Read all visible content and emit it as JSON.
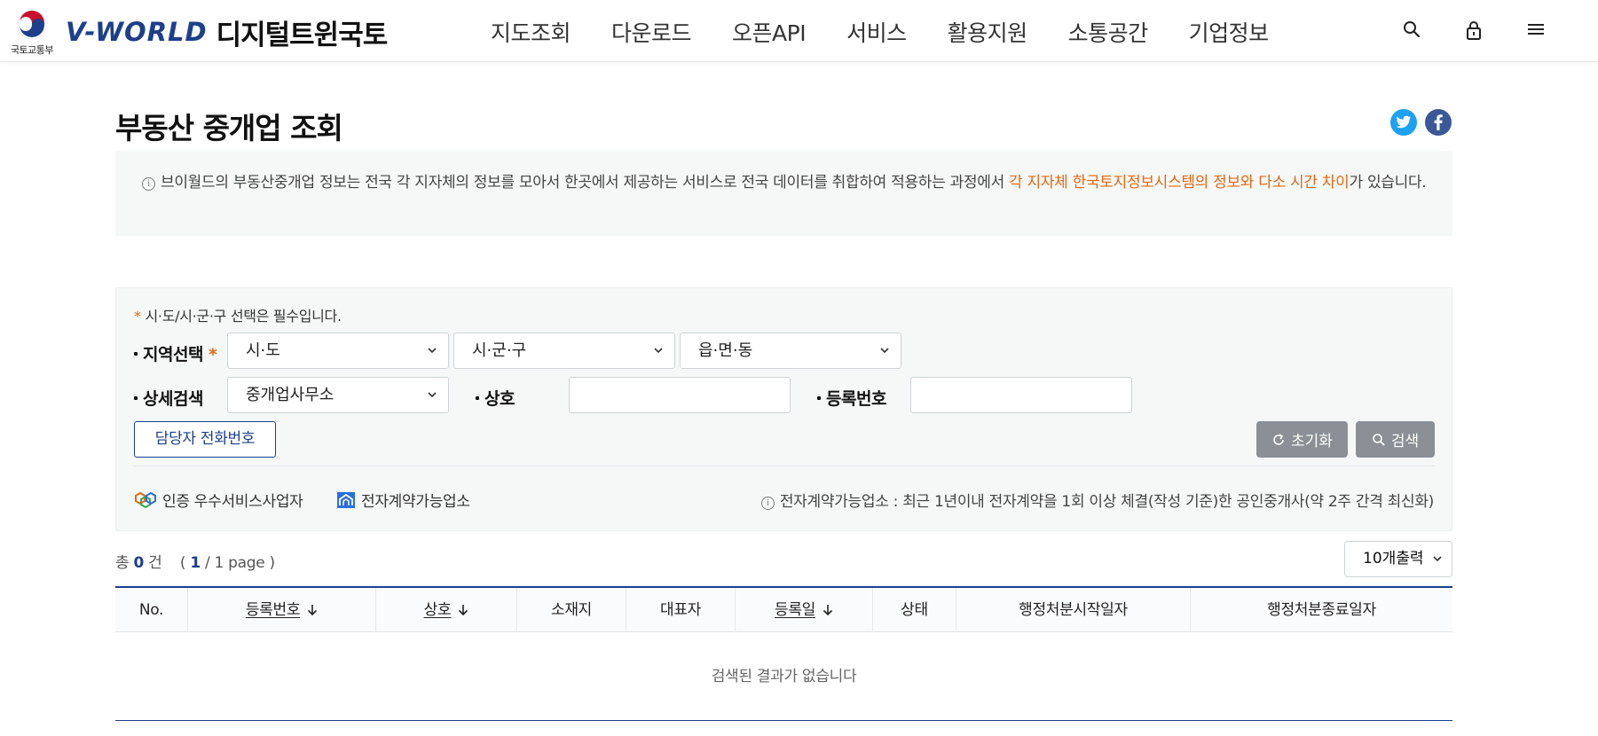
{
  "header": {
    "ministry_name": "국토교통부",
    "brand_latin": "V-WORLD",
    "brand_korean": "디지털트윈국토",
    "nav": [
      "지도조회",
      "다운로드",
      "오픈API",
      "서비스",
      "활용지원",
      "소통공간",
      "기업정보"
    ],
    "icons": [
      "search-icon",
      "lock-icon",
      "menu-icon"
    ]
  },
  "page": {
    "title": "부동산 중개업 조회"
  },
  "notice": {
    "text_before": "브이월드의 부동산중개업 정보는 전국 각 지자체의 정보를 모아서 한곳에서 제공하는 서비스로 전국 데이터를 취합하여 적용하는 과정에서 ",
    "highlight": "각 지자체 한국토지정보시스템의 정보와 다소 시간 차이",
    "text_after": "가 있습니다."
  },
  "search": {
    "required_note": "시·도/시·군·구 선택은 필수입니다.",
    "region_label": "지역선택",
    "sido": "시·도",
    "sigungu": "시·군·구",
    "eupmyeondong": "읍·면·동",
    "detail_label": "상세검색",
    "detail_select": "중개업사무소",
    "name_label": "상호",
    "name_value": "",
    "regno_label": "등록번호",
    "regno_value": "",
    "phone_button": "담당자 전화번호",
    "reset_button": "초기화",
    "search_button": "검색",
    "legend_certified": "인증 우수서비스사업자",
    "legend_econtract": "전자계약가능업소",
    "econtract_note": "전자계약가능업소 : 최근 1년이내 전자계약을 1회 이상 체결(작성 기준)한 공인중개사(약 2주 간격 최신화)"
  },
  "results": {
    "count_prefix": "총",
    "count": "0",
    "count_suffix": "건",
    "page_current": "1",
    "page_total": "/ 1 page )",
    "page_open": "(",
    "page_size": "10개출력",
    "columns": [
      "No.",
      "등록번호",
      "상호",
      "소재지",
      "대표자",
      "등록일",
      "상태",
      "행정처분시작일자",
      "행정처분종료일자"
    ],
    "empty_message": "검색된 결과가 없습니다"
  },
  "colors": {
    "primary": "#1d3f8c",
    "highlight": "#e8670f",
    "gray_button": "#8a9095"
  }
}
